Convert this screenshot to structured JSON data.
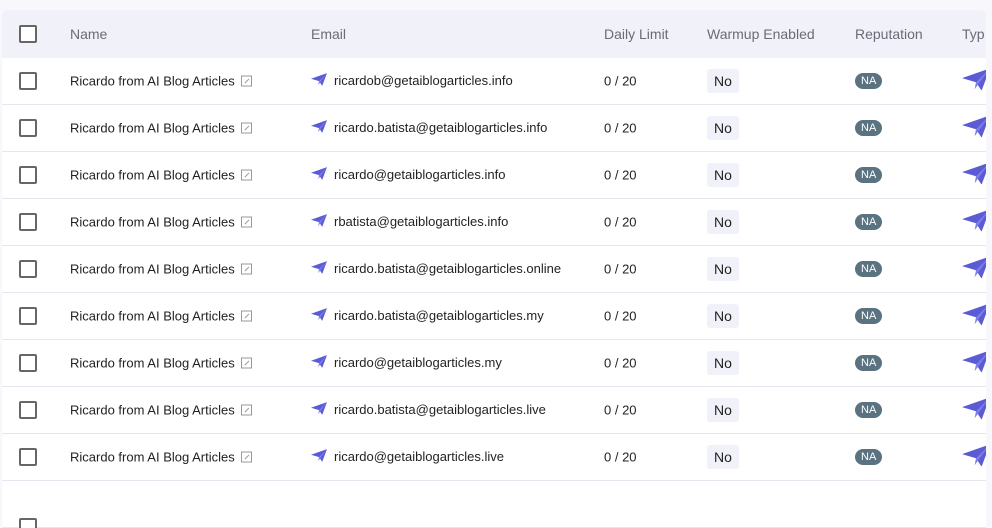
{
  "columns": {
    "name": "Name",
    "email": "Email",
    "daily_limit": "Daily Limit",
    "warmup": "Warmup Enabled",
    "reputation": "Reputation",
    "type": "Typ"
  },
  "accent": "#5b5bd6",
  "rows": [
    {
      "name": "Ricardo from AI Blog Articles",
      "email": "ricardob@getaiblogarticles.info",
      "daily": "0 / 20",
      "warmup": "No",
      "reputation": "NA"
    },
    {
      "name": "Ricardo from AI Blog Articles",
      "email": "ricardo.batista@getaiblogarticles.info",
      "daily": "0 / 20",
      "warmup": "No",
      "reputation": "NA"
    },
    {
      "name": "Ricardo from AI Blog Articles",
      "email": "ricardo@getaiblogarticles.info",
      "daily": "0 / 20",
      "warmup": "No",
      "reputation": "NA"
    },
    {
      "name": "Ricardo from AI Blog Articles",
      "email": "rbatista@getaiblogarticles.info",
      "daily": "0 / 20",
      "warmup": "No",
      "reputation": "NA"
    },
    {
      "name": "Ricardo from AI Blog Articles",
      "email": "ricardo.batista@getaiblogarticles.online",
      "daily": "0 / 20",
      "warmup": "No",
      "reputation": "NA"
    },
    {
      "name": "Ricardo from AI Blog Articles",
      "email": "ricardo.batista@getaiblogarticles.my",
      "daily": "0 / 20",
      "warmup": "No",
      "reputation": "NA"
    },
    {
      "name": "Ricardo from AI Blog Articles",
      "email": "ricardo@getaiblogarticles.my",
      "daily": "0 / 20",
      "warmup": "No",
      "reputation": "NA"
    },
    {
      "name": "Ricardo from AI Blog Articles",
      "email": "ricardo.batista@getaiblogarticles.live",
      "daily": "0 / 20",
      "warmup": "No",
      "reputation": "NA"
    },
    {
      "name": "Ricardo from AI Blog Articles",
      "email": "ricardo@getaiblogarticles.live",
      "daily": "0 / 20",
      "warmup": "No",
      "reputation": "NA"
    }
  ]
}
